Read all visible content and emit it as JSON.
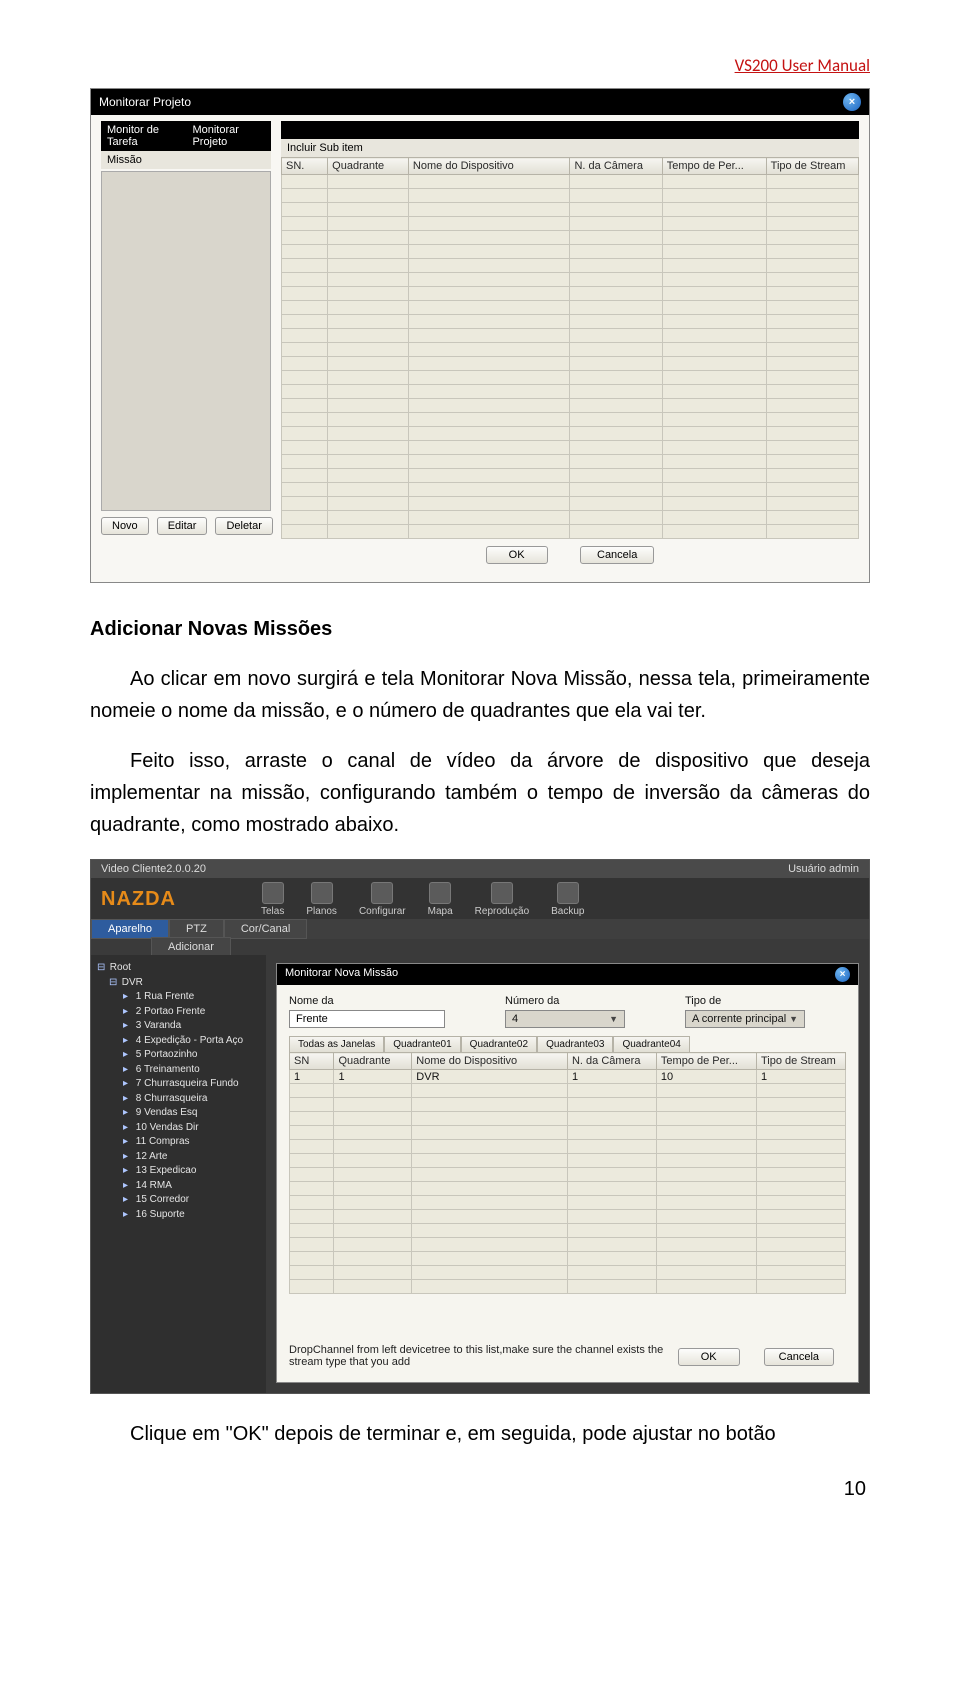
{
  "header_text": "VS200 User Manual",
  "page_number": "10",
  "screenshot1": {
    "title": "Monitorar Projeto",
    "left_tabs": [
      "Monitor de Tarefa",
      "Monitorar Projeto"
    ],
    "mission_label": "Missão",
    "buttons": {
      "novo": "Novo",
      "editar": "Editar",
      "deletar": "Deletar"
    },
    "right_tab": "",
    "subitem_label": "Incluir Sub item",
    "columns": [
      "SN.",
      "Quadrante",
      "Nome do Dispositivo",
      "N. da Câmera",
      "Tempo de Per...",
      "Tipo de Stream"
    ],
    "footer": {
      "ok": "OK",
      "cancel": "Cancela"
    }
  },
  "body1_title": "Adicionar Novas Missões",
  "body1_p1": "Ao clicar em novo surgirá e tela Monitorar Nova Missão, nessa tela, primeiramente nomeie o nome da missão, e o número de quadrantes que ela vai ter.",
  "body1_p2": "Feito isso, arraste o canal de vídeo da árvore de dispositivo que deseja implementar na missão, configurando também o tempo de inversão da câmeras do quadrante, como mostrado abaixo.",
  "screenshot2": {
    "app_title": "Video Cliente2.0.0.20",
    "user_label": "Usuário admin",
    "brand": "NAZDA",
    "toolbar": [
      "Telas",
      "Planos",
      "Configurar",
      "Mapa",
      "Reprodução",
      "Backup"
    ],
    "subtabs": {
      "aparelho": "Aparelho",
      "ptz": "PTZ",
      "corcanal": "Cor/Canal",
      "adicionar": "Adicionar"
    },
    "tree": {
      "root": "Root",
      "dvr": "DVR",
      "channels": [
        "1 Rua Frente",
        "2 Portao Frente",
        "3 Varanda",
        "4 Expedição - Porta Aço",
        "5 Portaozinho",
        "6 Treinamento",
        "7 Churrasqueira Fundo",
        "8 Churrasqueira",
        "9 Vendas Esq",
        "10 Vendas Dir",
        "11 Compras",
        "12 Arte",
        "13 Expedicao",
        "14 RMA",
        "15 Corredor",
        "16 Suporte"
      ]
    },
    "dialog": {
      "title": "Monitorar Nova Missão",
      "nome_label": "Nome da",
      "nome_value": "Frente",
      "numero_label": "Número da",
      "numero_value": "4",
      "tipo_label": "Tipo de",
      "tipo_value": "A corrente principal",
      "quad_tabs": [
        "Todas as Janelas",
        "Quadrante01",
        "Quadrante02",
        "Quadrante03",
        "Quadrante04"
      ],
      "columns": [
        "SN",
        "Quadrante",
        "Nome do Dispositivo",
        "N. da Câmera",
        "Tempo de Per...",
        "Tipo de Stream"
      ],
      "row": {
        "sn": "1",
        "quadrante": "1",
        "dispositivo": "DVR",
        "camera": "1",
        "tempo": "10",
        "tipo": "1"
      },
      "hint": "DropChannel from left devicetree to this list,make sure the channel exists the stream type that you add",
      "ok": "OK",
      "cancel": "Cancela"
    }
  },
  "body2_p1": "Clique em \"OK\" depois de terminar e, em seguida, pode ajustar no botão"
}
